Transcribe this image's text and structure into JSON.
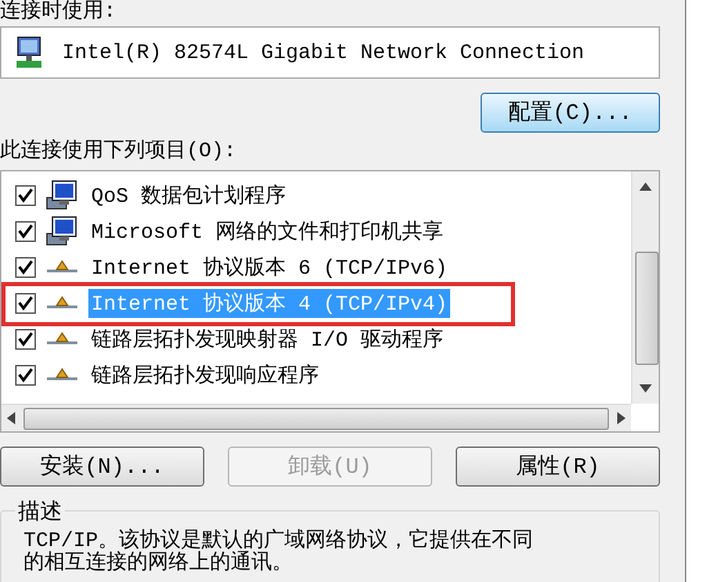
{
  "adapter_label": "连接时使用:",
  "adapter": {
    "name": "Intel(R) 82574L Gigabit Network Connection"
  },
  "configure_button": "配置(C)...",
  "items_label": "此连接使用下列项目(O):",
  "items": [
    {
      "label": "QoS 数据包计划程序",
      "kind": "service",
      "checked": true,
      "selected": false,
      "highlighted": false
    },
    {
      "label": "Microsoft 网络的文件和打印机共享",
      "kind": "service",
      "checked": true,
      "selected": false,
      "highlighted": false
    },
    {
      "label": "Internet 协议版本 6 (TCP/IPv6)",
      "kind": "protocol",
      "checked": true,
      "selected": false,
      "highlighted": false
    },
    {
      "label": "Internet 协议版本 4 (TCP/IPv4)",
      "kind": "protocol",
      "checked": true,
      "selected": true,
      "highlighted": true
    },
    {
      "label": "链路层拓扑发现映射器 I/O 驱动程序",
      "kind": "protocol",
      "checked": true,
      "selected": false,
      "highlighted": false
    },
    {
      "label": "链路层拓扑发现响应程序",
      "kind": "protocol",
      "checked": true,
      "selected": false,
      "highlighted": false
    }
  ],
  "buttons": [
    {
      "label": "安装(N)...",
      "disabled": false
    },
    {
      "label": "卸载(U)",
      "disabled": true
    },
    {
      "label": "属性(R)",
      "disabled": false
    }
  ],
  "description": {
    "title": "描述",
    "text": "TCP/IP。该协议是默认的广域网络协议，它提供在不同的相互连接的网络上的通讯。"
  }
}
